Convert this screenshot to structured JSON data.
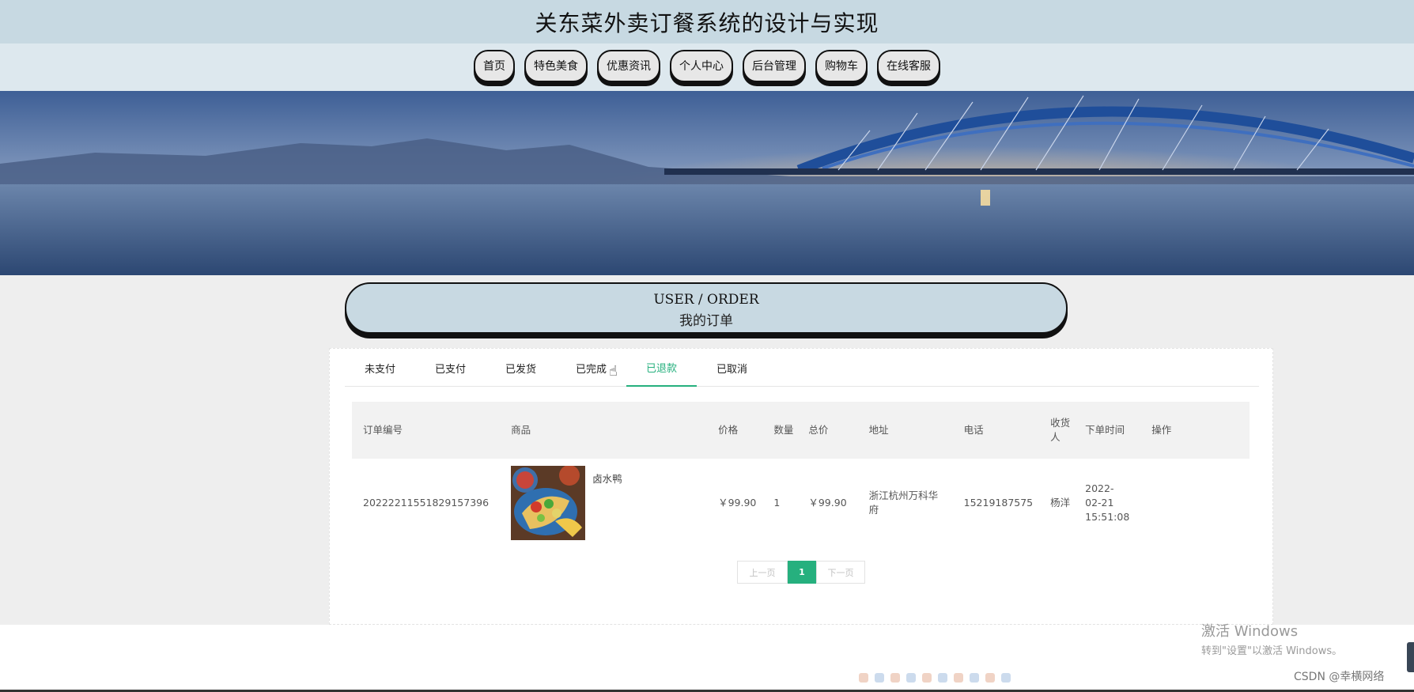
{
  "header": {
    "title": "关东菜外卖订餐系统的设计与实现"
  },
  "nav": {
    "items": [
      "首页",
      "特色美食",
      "优惠资讯",
      "个人中心",
      "后台管理",
      "购物车",
      "在线客服"
    ]
  },
  "section": {
    "title_en": "USER / ORDER",
    "title_cn": "我的订单"
  },
  "tabs": {
    "items": [
      "未支付",
      "已支付",
      "已发货",
      "已完成",
      "已退款",
      "已取消"
    ],
    "active": "已退款"
  },
  "table": {
    "headers": {
      "order_no": "订单编号",
      "product": "商品",
      "price": "价格",
      "qty": "数量",
      "total": "总价",
      "address": "地址",
      "phone": "电话",
      "receiver": "收货人",
      "order_time": "下单时间",
      "actions": "操作"
    },
    "rows": [
      {
        "order_no": "20222211551829157396",
        "product": "卤水鸭",
        "price": "￥99.90",
        "qty": "1",
        "total": "￥99.90",
        "address": "浙江杭州万科华府",
        "phone": "15219187575",
        "receiver": "杨洋",
        "order_time": "2022-02-21 15:51:08"
      }
    ]
  },
  "pager": {
    "prev": "上一页",
    "current": "1",
    "next": "下一页"
  },
  "overlay": {
    "activation_title": "激活 Windows",
    "activation_sub": "转到\"设置\"以激活 Windows。",
    "csdn": "CSDN @幸横网络"
  },
  "colors": {
    "accent": "#26b07e",
    "header_bg": "#c7d9e2",
    "nav_bg": "#dde8ee"
  }
}
